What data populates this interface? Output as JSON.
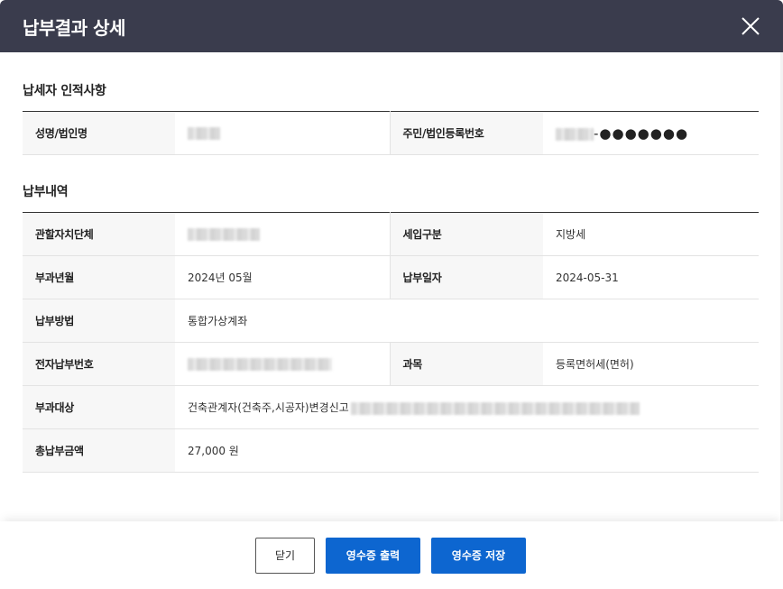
{
  "header": {
    "title": "납부결과 상세"
  },
  "taxpayer": {
    "section_title": "납세자 인적사항",
    "name_label": "성명/법인명",
    "regno_label": "주민/법인등록번호",
    "regno_mask": "-●●●●●●●"
  },
  "payment": {
    "section_title": "납부내역",
    "org_label": "관할자치단체",
    "tax_type_label": "세입구분",
    "tax_type_value": "지방세",
    "levy_month_label": "부과년월",
    "levy_month_value": "2024년 05월",
    "pay_date_label": "납부일자",
    "pay_date_value": "2024-05-31",
    "method_label": "납부방법",
    "method_value": "통합가상계좌",
    "epay_no_label": "전자납부번호",
    "item_label": "과목",
    "item_value": "등록면허세(면허)",
    "target_label": "부과대상",
    "target_value": "건축관계자(건축주,시공자)변경신고",
    "total_label": "총납부금액",
    "total_value": "27,000 원"
  },
  "footer": {
    "close_label": "닫기",
    "print_label": "영수증 출력",
    "save_label": "영수증 저장"
  },
  "colors": {
    "header_bg": "#3a3c4d",
    "primary": "#0d66d0"
  }
}
